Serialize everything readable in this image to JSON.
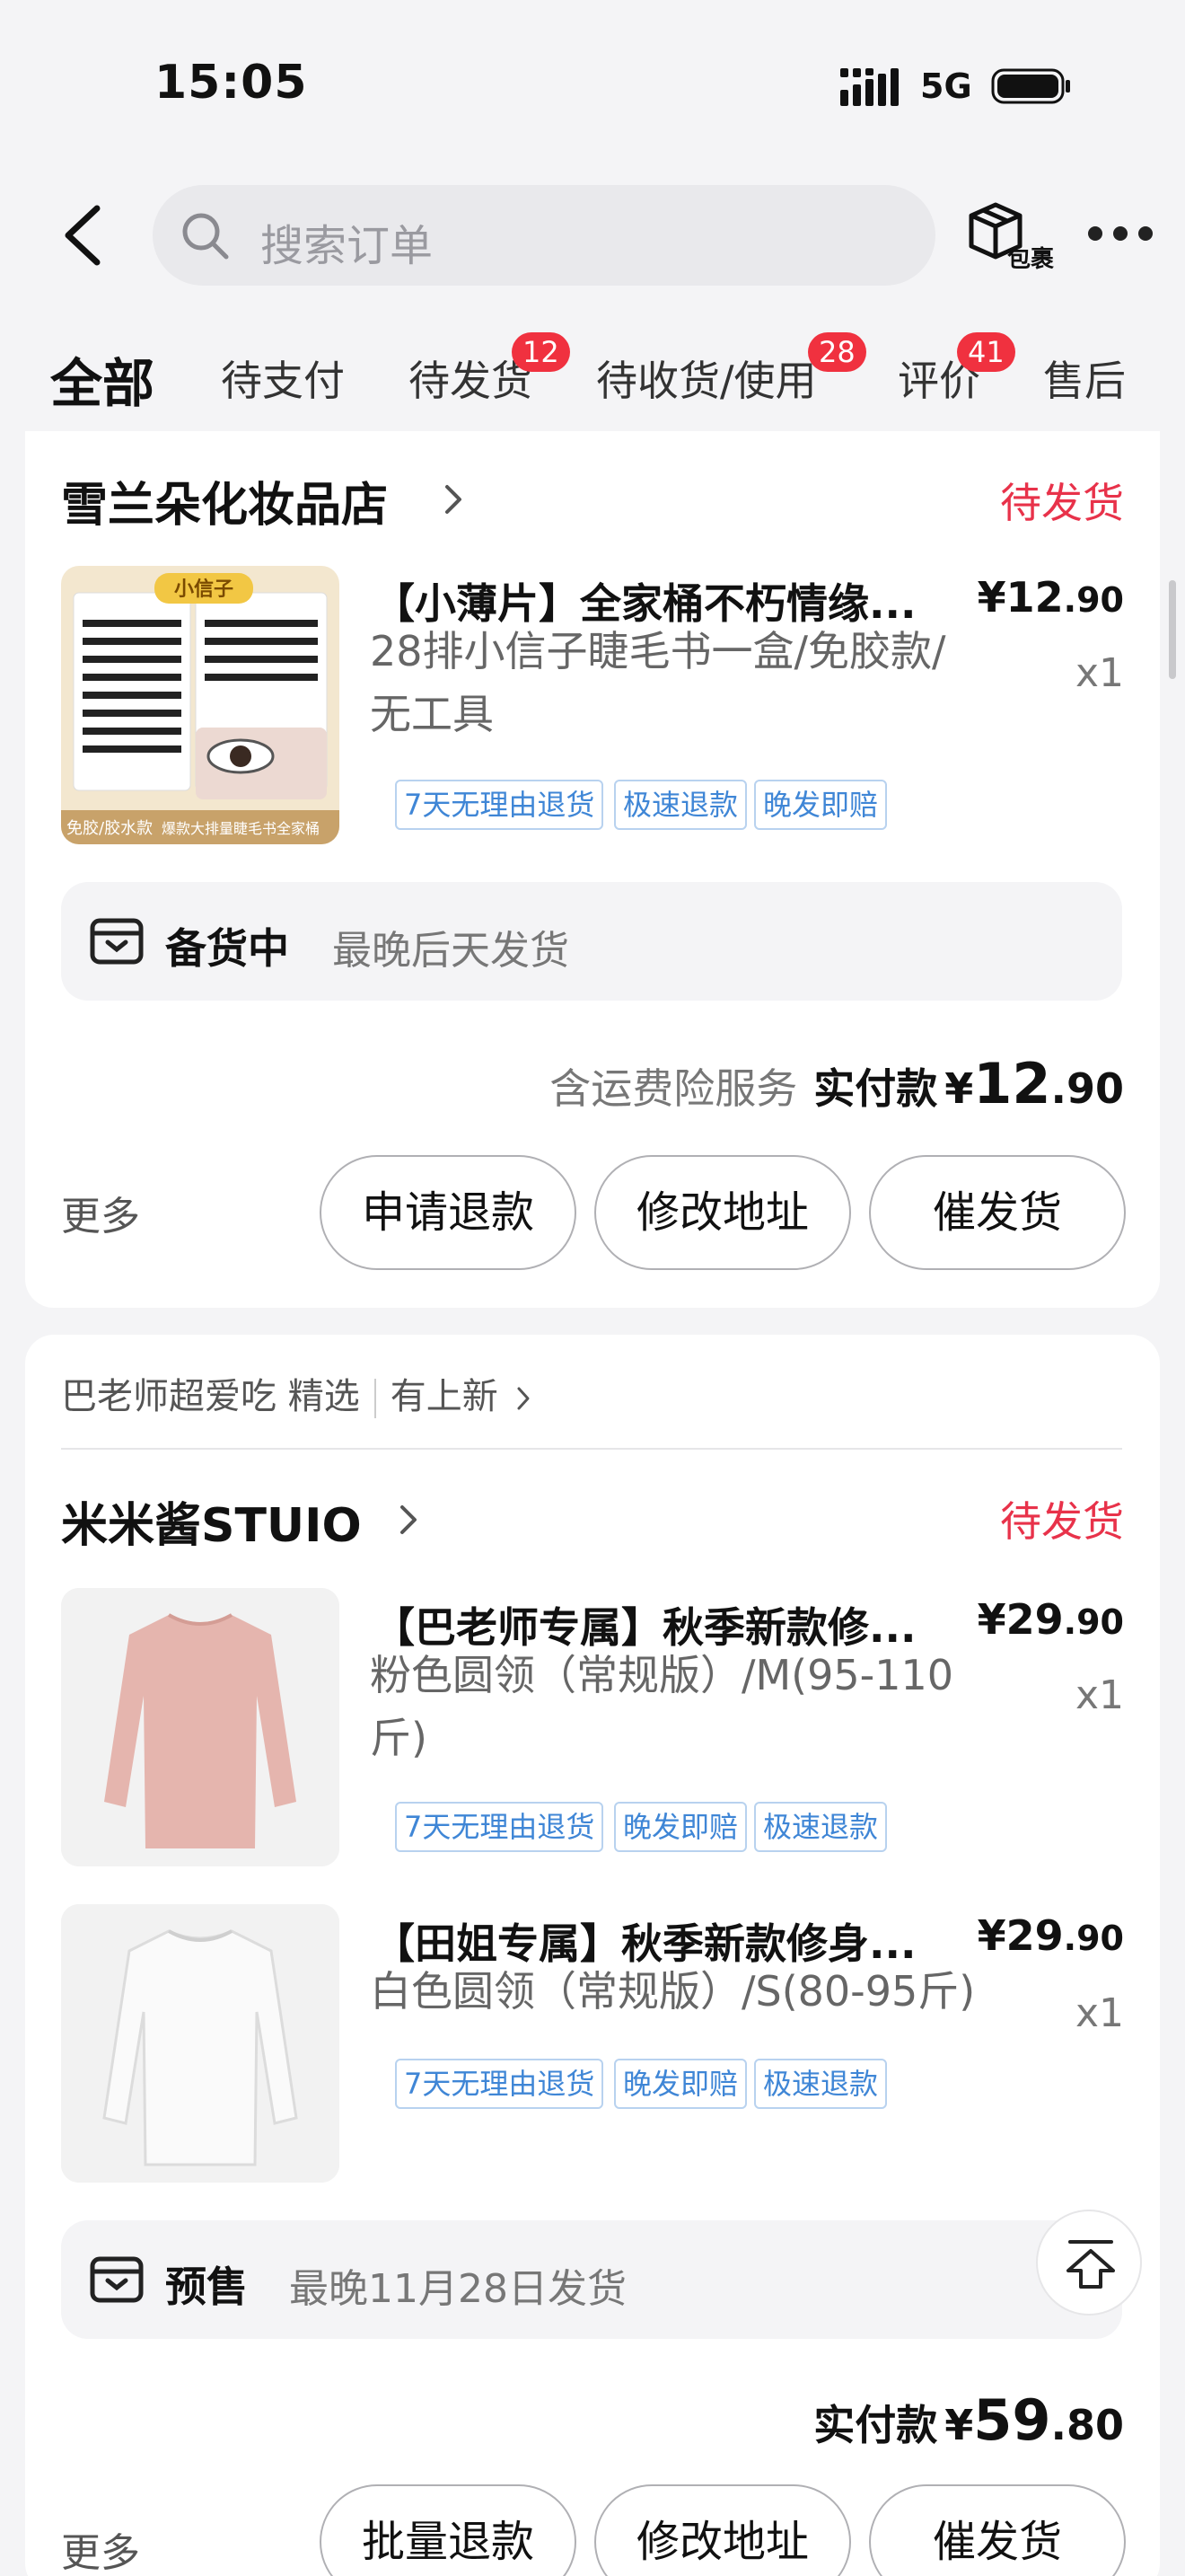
{
  "status_bar": {
    "time": "15:05",
    "network": "5G"
  },
  "header": {
    "search_placeholder": "搜索订单",
    "package_label": "包裹"
  },
  "tabs": [
    {
      "label": "全部",
      "active": true
    },
    {
      "label": "待支付"
    },
    {
      "label": "待发货",
      "badge": "12"
    },
    {
      "label": "待收货/使用",
      "badge": "28"
    },
    {
      "label": "评价",
      "badge": "41"
    },
    {
      "label": "售后"
    }
  ],
  "orders": [
    {
      "shop": "雪兰朵化妆品店",
      "status": "待发货",
      "items": [
        {
          "title": "【小薄片】全家桶不朽情缘...",
          "spec": "28排小信子睫毛书一盒/免胶款/无工具",
          "price_yen": "¥",
          "price_int": "12",
          "price_dec": ".90",
          "qty": "x1",
          "tags": [
            "7天无理由退货",
            "极速退款",
            "晚发即赔"
          ],
          "image": {
            "brand": "小信子",
            "corner": "免胶/胶水款",
            "caption": "爆款大排量睫毛书全家桶"
          }
        }
      ],
      "shipping": {
        "state": "备货中",
        "note": "最晚后天发货"
      },
      "total": {
        "insurance": "含运费险服务",
        "label": "实付款",
        "yen": "¥",
        "int": "12",
        "dec": ".90"
      },
      "more": "更多",
      "buttons": [
        "申请退款",
        "修改地址",
        "催发货"
      ]
    },
    {
      "promo": {
        "text1": "巴老师超爱吃 精选",
        "text2": "有上新"
      },
      "shop": "米米酱STUIO",
      "status": "待发货",
      "items": [
        {
          "title": "【巴老师专属】秋季新款修...",
          "spec": "粉色圆领（常规版）/M(95-110斤)",
          "price_yen": "¥",
          "price_int": "29",
          "price_dec": ".90",
          "qty": "x1",
          "tags": [
            "7天无理由退货",
            "晚发即赔",
            "极速退款"
          ]
        },
        {
          "title": "【田姐专属】秋季新款修身...",
          "spec": "白色圆领（常规版）/S(80-95斤)",
          "price_yen": "¥",
          "price_int": "29",
          "price_dec": ".90",
          "qty": "x1",
          "tags": [
            "7天无理由退货",
            "晚发即赔",
            "极速退款"
          ]
        }
      ],
      "shipping": {
        "state": "预售",
        "note": "最晚11月28日发货"
      },
      "total": {
        "label": "实付款",
        "yen": "¥",
        "int": "59",
        "dec": ".80"
      },
      "more": "更多",
      "buttons": [
        "批量退款",
        "修改地址",
        "催发货"
      ]
    }
  ],
  "colors": {
    "accent_red": "#e8324a",
    "tag_blue": "#3f86d6",
    "background": "#f4f4f6"
  }
}
